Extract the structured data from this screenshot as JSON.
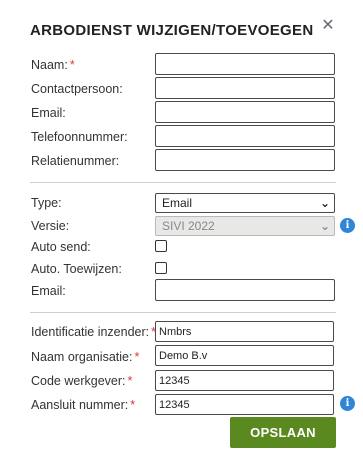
{
  "dialog": {
    "title": "ARBODIENST WIJZIGEN/TOEVOEGEN",
    "close_label": "✕"
  },
  "section1": {
    "naam": {
      "label": "Naam:",
      "required": "*",
      "value": ""
    },
    "contactpersoon": {
      "label": "Contactpersoon:",
      "value": ""
    },
    "email": {
      "label": "Email:",
      "value": ""
    },
    "telefoonnummer": {
      "label": "Telefoonnummer:",
      "value": ""
    },
    "relatienummer": {
      "label": "Relatienummer:",
      "value": ""
    }
  },
  "section2": {
    "type": {
      "label": "Type:",
      "selected": "Email",
      "chevron": "⌄"
    },
    "versie": {
      "label": "Versie:",
      "selected": "SIVI 2022",
      "chevron": "⌄",
      "disabled": true,
      "info": "i"
    },
    "auto_send": {
      "label": "Auto send:",
      "checked": false
    },
    "auto_toewijzen": {
      "label": "Auto. Toewijzen:",
      "checked": false
    },
    "email": {
      "label": "Email:",
      "value": ""
    }
  },
  "section3": {
    "identificatie": {
      "label": "Identificatie inzender:",
      "required": "*",
      "value": "Nmbrs"
    },
    "naam_organisatie": {
      "label": "Naam organisatie:",
      "required": "*",
      "value": "Demo B.v"
    },
    "code_werkgever": {
      "label": "Code werkgever:",
      "required": "*",
      "value": "12345"
    },
    "aansluit_nummer": {
      "label": "Aansluit nummer:",
      "required": "*",
      "value": "12345",
      "info": "i"
    }
  },
  "actions": {
    "save_label": "OPSLAAN"
  },
  "colors": {
    "primary_button": "#5a8a1f",
    "info_icon": "#2f86d6",
    "required": "#d9363e"
  }
}
